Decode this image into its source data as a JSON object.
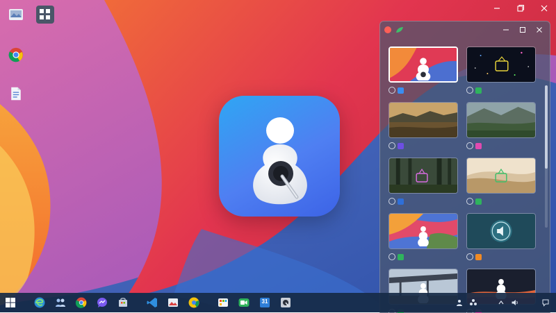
{
  "desktop": {
    "icons": [
      {
        "id": "photos",
        "label": "",
        "icon": "image-stack-icon"
      },
      {
        "id": "settings",
        "label": "",
        "icon": "grid-app-icon"
      },
      {
        "id": "chrome",
        "label": "",
        "icon": "chrome-icon"
      },
      {
        "id": "document",
        "label": "",
        "icon": "document-icon"
      }
    ]
  },
  "window_controls": [
    "minimize-icon",
    "restore-icon",
    "close-icon"
  ],
  "theme_window": {
    "title": "",
    "tiles": [
      {
        "name": "",
        "tag_color": "#3b8df0",
        "selected": true
      },
      {
        "name": "",
        "tag_color": "#2fb35d",
        "selected": false
      },
      {
        "name": "",
        "tag_color": "#6d4fe3",
        "selected": false
      },
      {
        "name": "",
        "tag_color": "#e04ab0",
        "selected": false
      },
      {
        "name": "",
        "tag_color": "#2f6fd8",
        "selected": false
      },
      {
        "name": "",
        "tag_color": "#2fb35d",
        "selected": false
      },
      {
        "name": "",
        "tag_color": "#2fb35d",
        "selected": false
      },
      {
        "name": "",
        "tag_color": "#f08a24",
        "selected": false
      },
      {
        "name": "",
        "tag_color": "#2fb35d",
        "selected": false
      },
      {
        "name": "",
        "tag_color": "#e04ab0",
        "selected": false
      }
    ]
  },
  "taskbar": {
    "items": [
      "windows-start-icon",
      "edge-icon",
      "people-icon",
      "chrome-icon",
      "messenger-icon",
      "store-icon",
      "vscode-icon",
      "photos-icon",
      "chrome-alt-icon",
      "apps-icon",
      "facetime-icon",
      "calendar-icon",
      "camera-icon"
    ],
    "calendar_day": "31",
    "tray_text": "",
    "clock": ""
  },
  "colors": {
    "accent": "#3c7ff0",
    "taskbar_bg": "#162a46",
    "window_bg": "#4a566e"
  }
}
